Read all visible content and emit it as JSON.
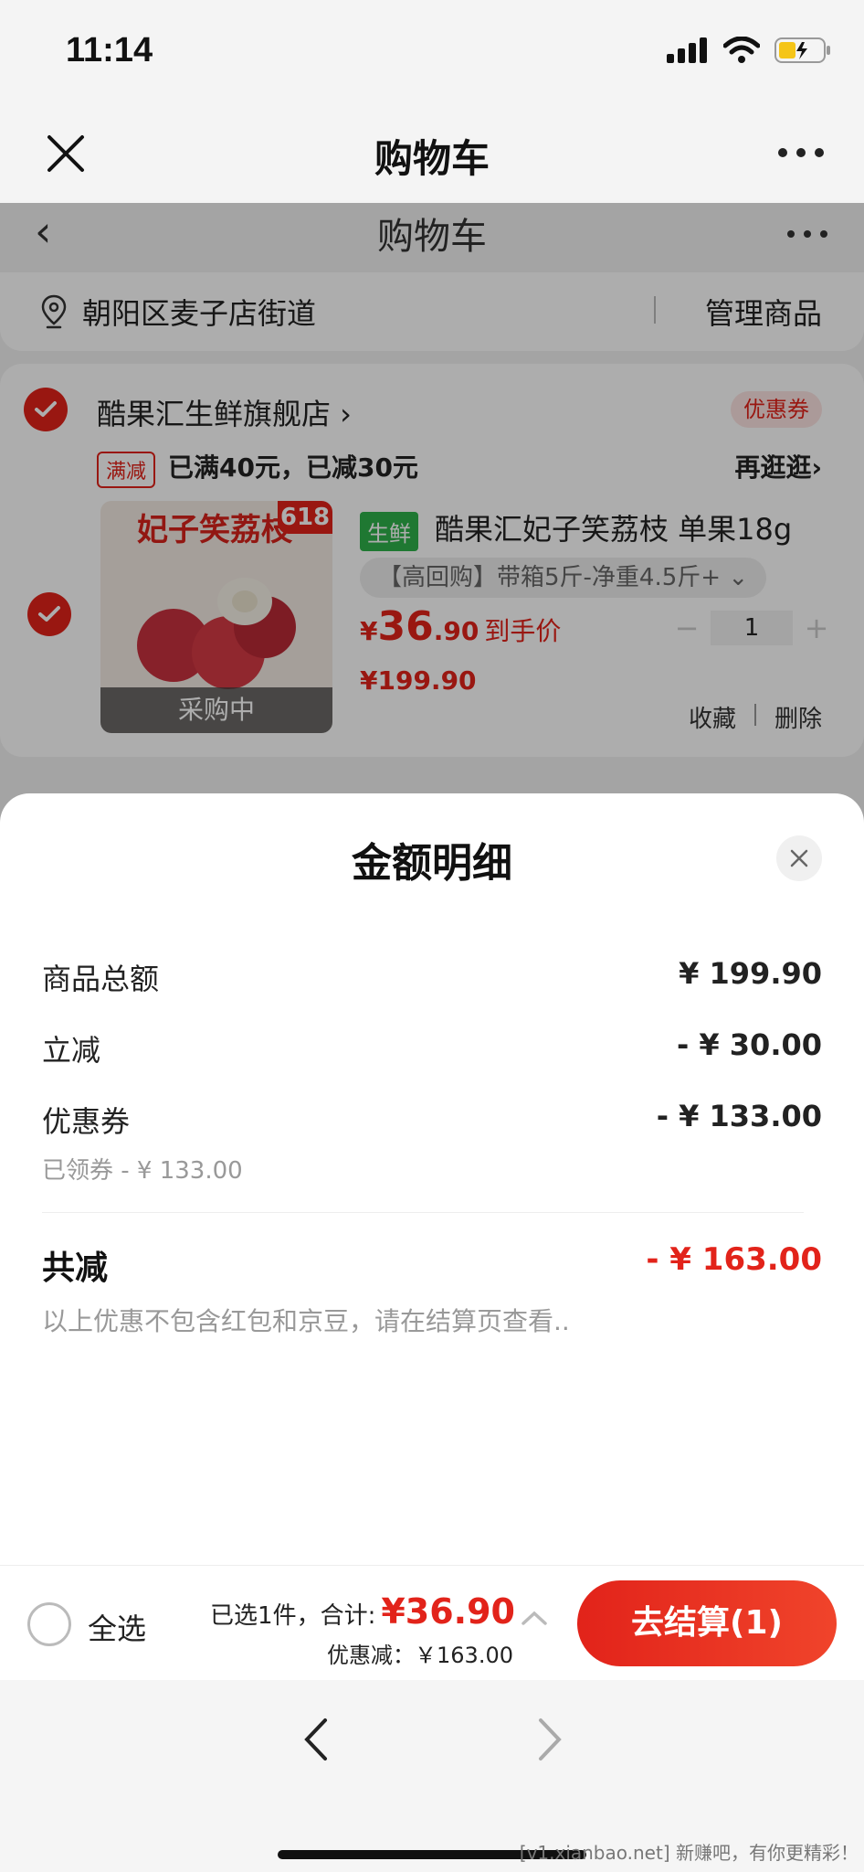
{
  "status": {
    "time": "11:14"
  },
  "nav": {
    "title": "购物车"
  },
  "page": {
    "sub_title": "购物车",
    "address": "朝阳区麦子店街道",
    "manage": "管理商品",
    "store": {
      "name": "酷果汇生鲜旗舰店 ›",
      "coupon": "优惠券",
      "promo_tag": "满减",
      "promo_text": "已满40元，已减30元",
      "promo_more": "再逛逛›"
    },
    "product": {
      "image_title": "妃子笑荔枝",
      "badge": "618",
      "overlay": "采购中",
      "category": "生鲜",
      "title": "酷果汇妃子笑荔枝 单果18g",
      "spec": "【高回购】带箱5斤-净重4.5斤+ ⌄",
      "price_yen": "¥",
      "price_int": "36",
      "price_dec": ".90",
      "price_label": "到手价",
      "price_orig": "¥199.90",
      "qty": "1",
      "fav": "收藏",
      "del": "删除"
    }
  },
  "sheet": {
    "title": "金额明细",
    "rows": [
      {
        "label": "商品总额",
        "value": "¥ 199.90"
      },
      {
        "label": "立减",
        "value": "- ¥ 30.00"
      },
      {
        "label": "优惠券",
        "value": "- ¥ 133.00",
        "sub": "已领券 - ¥ 133.00"
      }
    ],
    "total_label": "共减",
    "total_value": "- ¥ 163.00",
    "note": "以上优惠不包含红包和京豆，请在结算页查看.."
  },
  "checkout": {
    "select_all": "全选",
    "selected_text": "已选1件，合计:",
    "total": "¥36.90",
    "discount": "优惠减：￥163.00",
    "button": "去结算(1)"
  },
  "watermark": "[v1.xianbao.net] 新赚吧，有你更精彩！",
  "colors": {
    "accent": "#e2231a",
    "green": "#2fb24b"
  }
}
